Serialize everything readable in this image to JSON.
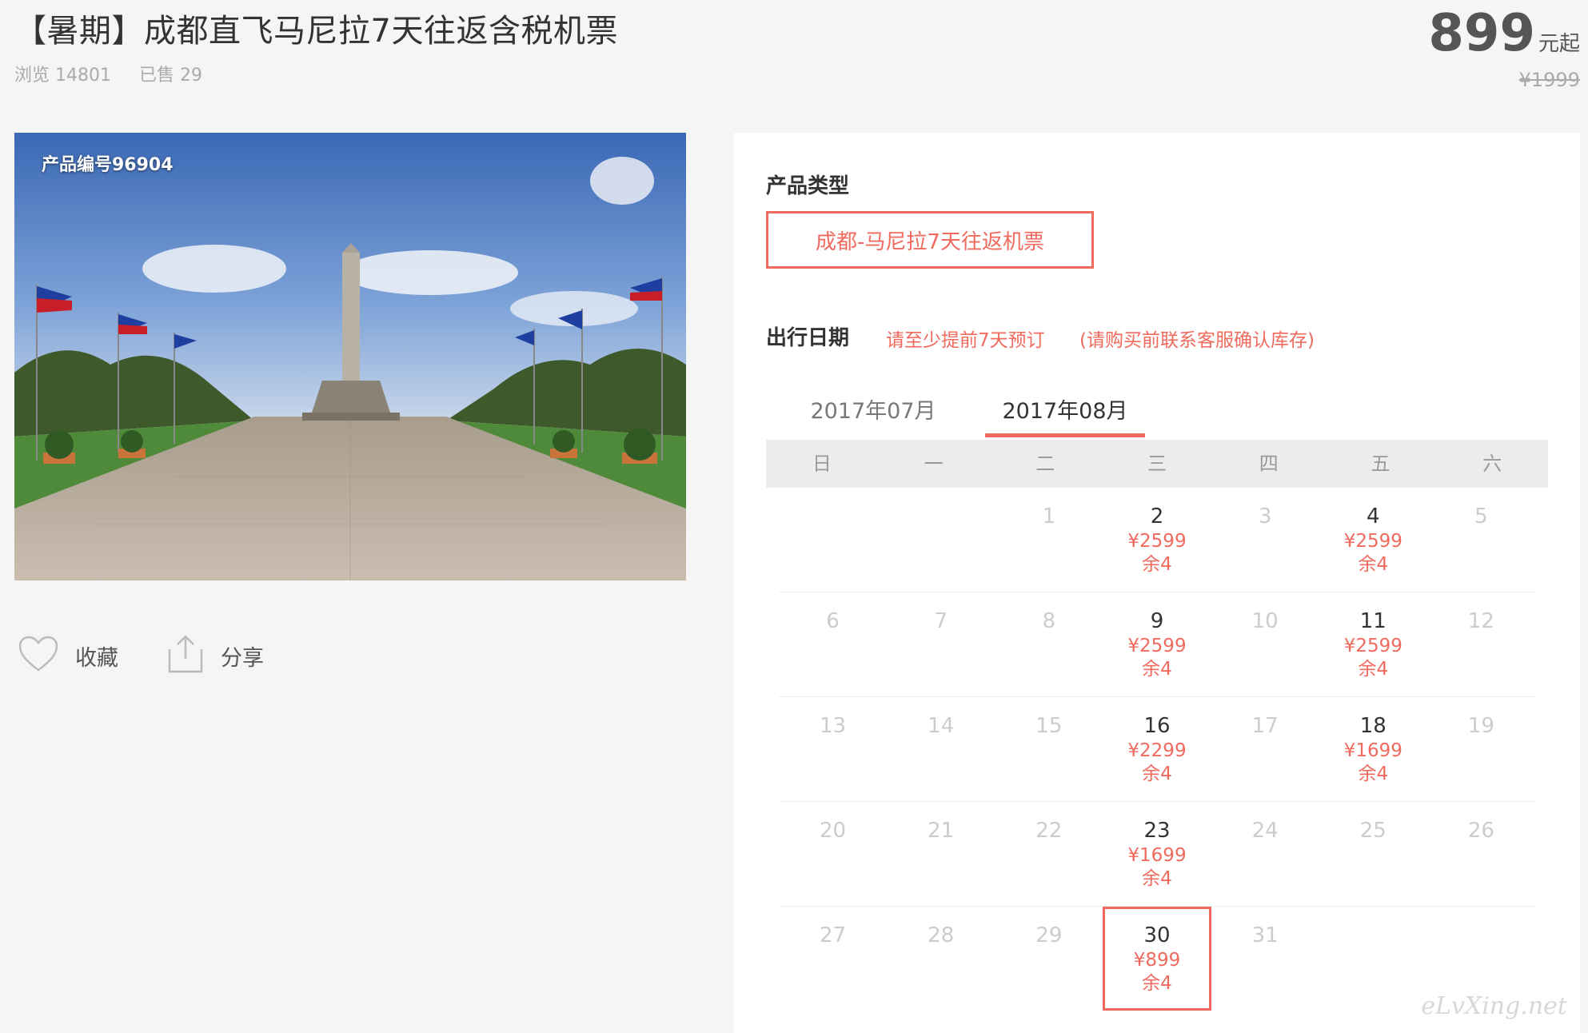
{
  "header": {
    "title": "【暑期】成都直飞马尼拉7天往返含税机票",
    "views": "浏览 14801",
    "sold": "已售 29"
  },
  "price": {
    "amount": "899",
    "unit": "元起",
    "original": "¥1999"
  },
  "photo": {
    "product_code": "产品编号96904"
  },
  "actions": {
    "favorite_label": "收藏",
    "favorite_icon": "heart-icon",
    "share_label": "分享",
    "share_icon": "share-icon"
  },
  "booking": {
    "type_label": "产品类型",
    "type_option": "成都-马尼拉7天往返机票",
    "date_label": "出行日期",
    "note1": "请至少提前7天预订",
    "note2": "(请购买前联系客服确认库存)",
    "tabs": [
      "2017年07月",
      "2017年08月"
    ],
    "active_tab": 1,
    "weekdays": [
      "日",
      "一",
      "二",
      "三",
      "四",
      "五",
      "六"
    ],
    "weeks": [
      [
        {
          "d": ""
        },
        {
          "d": ""
        },
        {
          "d": "1"
        },
        {
          "d": "2",
          "price": "¥2599",
          "stock": "余4"
        },
        {
          "d": "3"
        },
        {
          "d": "4",
          "price": "¥2599",
          "stock": "余4"
        },
        {
          "d": "5"
        }
      ],
      [
        {
          "d": "6"
        },
        {
          "d": "7"
        },
        {
          "d": "8"
        },
        {
          "d": "9",
          "price": "¥2599",
          "stock": "余4"
        },
        {
          "d": "10"
        },
        {
          "d": "11",
          "price": "¥2599",
          "stock": "余4"
        },
        {
          "d": "12"
        }
      ],
      [
        {
          "d": "13"
        },
        {
          "d": "14"
        },
        {
          "d": "15"
        },
        {
          "d": "16",
          "price": "¥2299",
          "stock": "余4"
        },
        {
          "d": "17"
        },
        {
          "d": "18",
          "price": "¥1699",
          "stock": "余4"
        },
        {
          "d": "19"
        }
      ],
      [
        {
          "d": "20"
        },
        {
          "d": "21"
        },
        {
          "d": "22"
        },
        {
          "d": "23",
          "price": "¥1699",
          "stock": "余4"
        },
        {
          "d": "24"
        },
        {
          "d": "25"
        },
        {
          "d": "26"
        }
      ],
      [
        {
          "d": "27"
        },
        {
          "d": "28"
        },
        {
          "d": "29"
        },
        {
          "d": "30",
          "price": "¥899",
          "stock": "余4",
          "selected": true
        },
        {
          "d": "31"
        },
        {
          "d": ""
        },
        {
          "d": ""
        }
      ]
    ]
  },
  "watermark": "eLvXing.net",
  "colors": {
    "accent": "#f06a5e",
    "text": "#333333",
    "muted": "#aaaaaa"
  }
}
